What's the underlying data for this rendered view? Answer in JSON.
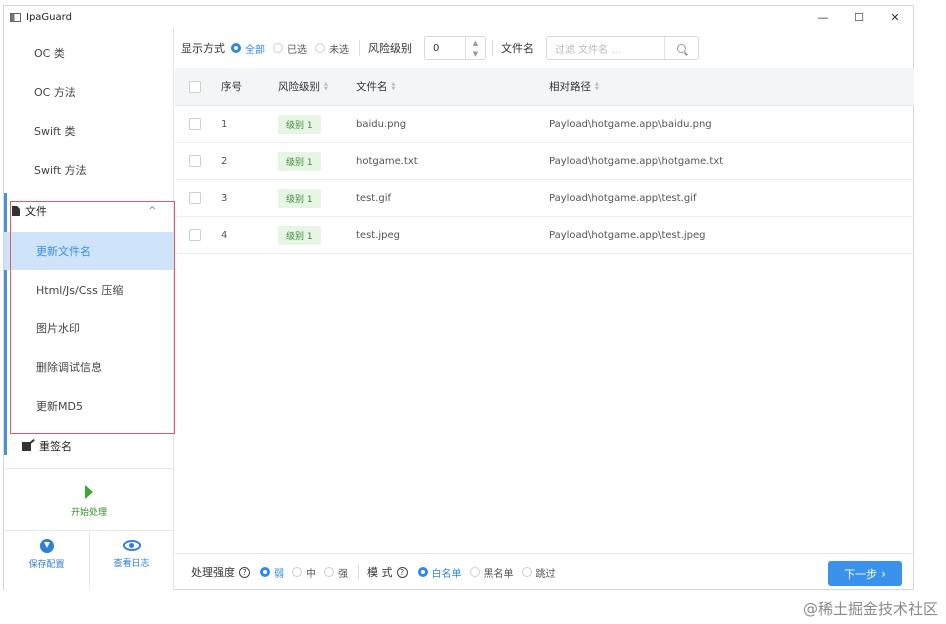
{
  "window": {
    "title": "IpaGuard",
    "controls": [
      "—",
      "☐",
      "✕"
    ]
  },
  "sidebar": {
    "items": [
      {
        "label": "OC 类"
      },
      {
        "label": "OC 方法"
      },
      {
        "label": "Swift 类"
      },
      {
        "label": "Swift 方法"
      }
    ],
    "file_group": {
      "label": "文件",
      "chevron": "^",
      "children": [
        {
          "label": "更新文件名",
          "active": true
        },
        {
          "label": "Html/Js/Css 压缩"
        },
        {
          "label": "图片水印"
        },
        {
          "label": "删除调试信息"
        },
        {
          "label": "更新MD5"
        }
      ]
    },
    "resign": {
      "label": "重签名"
    },
    "start": {
      "label": "开始处理"
    },
    "save_config": {
      "label": "保存配置"
    },
    "view_log": {
      "label": "查看日志"
    }
  },
  "toolbar": {
    "display_label": "显示方式",
    "display_options": [
      {
        "label": "全部",
        "selected": true
      },
      {
        "label": "已选",
        "selected": false
      },
      {
        "label": "未选",
        "selected": false
      }
    ],
    "risk_label": "风险级别",
    "risk_value": "0",
    "filename_label": "文件名",
    "search_placeholder": "过滤 文件名 ..."
  },
  "table": {
    "headers": {
      "index": "序号",
      "risk": "风险级别",
      "name": "文件名",
      "path": "相对路径"
    },
    "rows": [
      {
        "index": "1",
        "risk": "级别 1",
        "name": "baidu.png",
        "path": "Payload\\hotgame.app\\baidu.png"
      },
      {
        "index": "2",
        "risk": "级别 1",
        "name": "hotgame.txt",
        "path": "Payload\\hotgame.app\\hotgame.txt"
      },
      {
        "index": "3",
        "risk": "级别 1",
        "name": "test.gif",
        "path": "Payload\\hotgame.app\\test.gif"
      },
      {
        "index": "4",
        "risk": "级别 1",
        "name": "test.jpeg",
        "path": "Payload\\hotgame.app\\test.jpeg"
      }
    ]
  },
  "footer": {
    "strength_label": "处理强度",
    "strength_options": [
      {
        "label": "弱",
        "selected": true
      },
      {
        "label": "中",
        "selected": false
      },
      {
        "label": "强",
        "selected": false
      }
    ],
    "mode_label": "模 式",
    "mode_options": [
      {
        "label": "白名单",
        "selected": true
      },
      {
        "label": "黑名单",
        "selected": false
      },
      {
        "label": "跳过",
        "selected": false
      }
    ],
    "next_label": "下一步",
    "next_icon": "chevron-right-icon"
  },
  "watermark": "@稀土掘金技术社区",
  "colors": {
    "accent": "#3a92ec",
    "active_bg": "#cfe3fb",
    "highlight_border": "#e05a64",
    "badge_bg": "#e6f5e4",
    "start_green": "#3aa832"
  }
}
